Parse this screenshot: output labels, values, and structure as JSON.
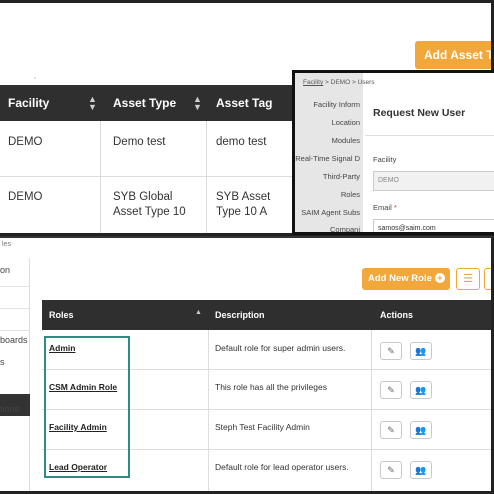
{
  "assets": {
    "add_button": "Add Asset Tag",
    "columns": [
      "Facility",
      "Asset Type",
      "Asset Tag"
    ],
    "rows": [
      {
        "facility": "DEMO",
        "asset_type": "Demo test",
        "asset_tag": "demo test"
      },
      {
        "facility": "DEMO",
        "asset_type": "SYB Global Asset Type 10",
        "asset_tag": "SYB Asset Type 10 A"
      }
    ]
  },
  "request_user": {
    "breadcrumb": [
      "Facility",
      ">",
      "DEMO",
      ">",
      "Users"
    ],
    "nav_items": [
      "Facility Inform",
      "Location",
      "Modules",
      "Real-Time Signal D",
      "Third-Party",
      "Roles",
      "SAIM Agent Subs",
      "Compani"
    ],
    "modal_title": "Request New User",
    "facility_label": "Facility",
    "facility_value": "DEMO",
    "email_label": "Email",
    "required_mark": "*",
    "email_value": "samos@saim.com"
  },
  "roles": {
    "panel_fragment": "les",
    "sidebar_items": [
      "on",
      "boards",
      "s",
      "tions"
    ],
    "add_button": "Add New Role",
    "columns": [
      "Roles",
      "Description",
      "Actions"
    ],
    "rows": [
      {
        "role": "Admin",
        "description": "Default role for super admin users."
      },
      {
        "role": "CSM Admin Role",
        "description": "This role has all the privileges"
      },
      {
        "role": "Facility Admin",
        "description": "Steph Test Facility Admin"
      },
      {
        "role": "Lead Operator",
        "description": "Default role for lead operator users."
      }
    ]
  },
  "colors": {
    "accent": "#f2a73b",
    "header_dark": "#2f2f2f",
    "highlight_box": "#2f8b86"
  }
}
